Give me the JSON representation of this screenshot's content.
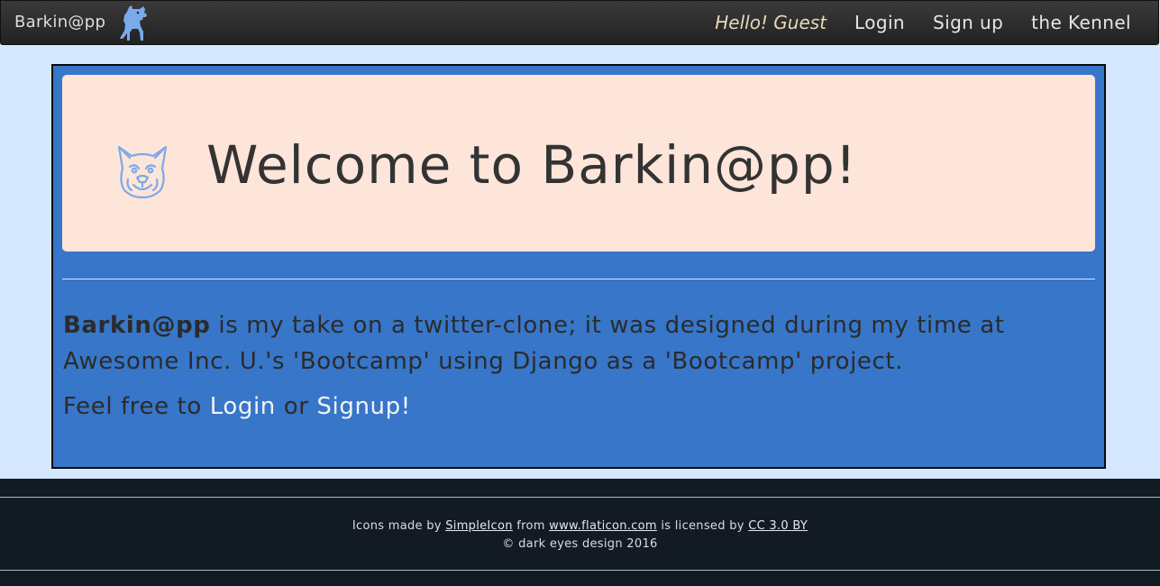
{
  "navbar": {
    "brand": "Barkin@pp",
    "brand_logo_icon": "dog-icon",
    "greeting": "Hello! Guest",
    "links": [
      "Login",
      "Sign up",
      "the Kennel"
    ]
  },
  "jumbotron": {
    "icon": "french-bulldog-icon",
    "title": "Welcome to Barkin@pp!"
  },
  "content": {
    "brand_bold": "Barkin@pp",
    "description_1": " is my take on a twitter-clone; it was designed during my time at",
    "description_2": "Awesome Inc. U.'s 'Bootcamp' using Django as a 'Bootcamp' project.",
    "cta_prefix": "Feel free to ",
    "cta_login": "Login",
    "cta_or": " or ",
    "cta_signup": "Signup!"
  },
  "footer": {
    "icons_prefix": "Icons made by ",
    "author_link": "SimpleIcon",
    "from_text": " from ",
    "site_link": "www.flaticon.com",
    "licensed_text": " is licensed by ",
    "license_link": "CC 3.0 BY",
    "copyright": "© dark eyes design 2016"
  },
  "colors": {
    "page_bg": "#d6e8ff",
    "navbar_bg": "#2a2a2a",
    "panel_bg": "#3776c9",
    "jumbotron_bg": "#fee5d9",
    "footer_bg": "#121a24",
    "icon_blue": "#7aaae8"
  }
}
